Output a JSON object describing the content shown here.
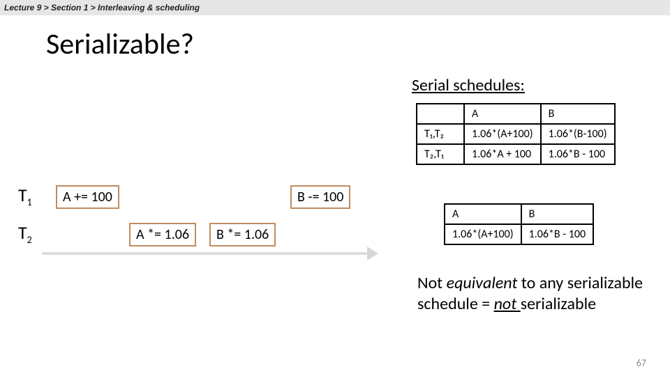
{
  "breadcrumb": "Lecture 9 > Section 1 > Interleaving & scheduling",
  "title": "Serializable?",
  "serial_heading": "Serial schedules:",
  "table1": {
    "headA": "A",
    "headB": "B",
    "r1c0": "T₁,T₂",
    "r1c1": "1.06*(A+100)",
    "r1c2": "1.06*(B-100)",
    "r2c0": "T₂,T₁",
    "r2c1": "1.06*A + 100",
    "r2c2": "1.06*B - 100"
  },
  "table2": {
    "headA": "A",
    "headB": "B",
    "r1c0": "1.06*(A+100)",
    "r1c1": "1.06*B - 100"
  },
  "ops": {
    "t1_label_base": "T",
    "t1_label_sub": "1",
    "t2_label_base": "T",
    "t2_label_sub": "2",
    "a1": "A += 100",
    "a2": "A *= 1.06",
    "b2": "B *= 1.06",
    "b1": "B -= 100"
  },
  "conclusion": {
    "pre": "Not ",
    "equiv": "equivalent ",
    "mid": "to any serializable schedule = ",
    "not": "not ",
    "tail": "serializable"
  },
  "page_num": "67"
}
